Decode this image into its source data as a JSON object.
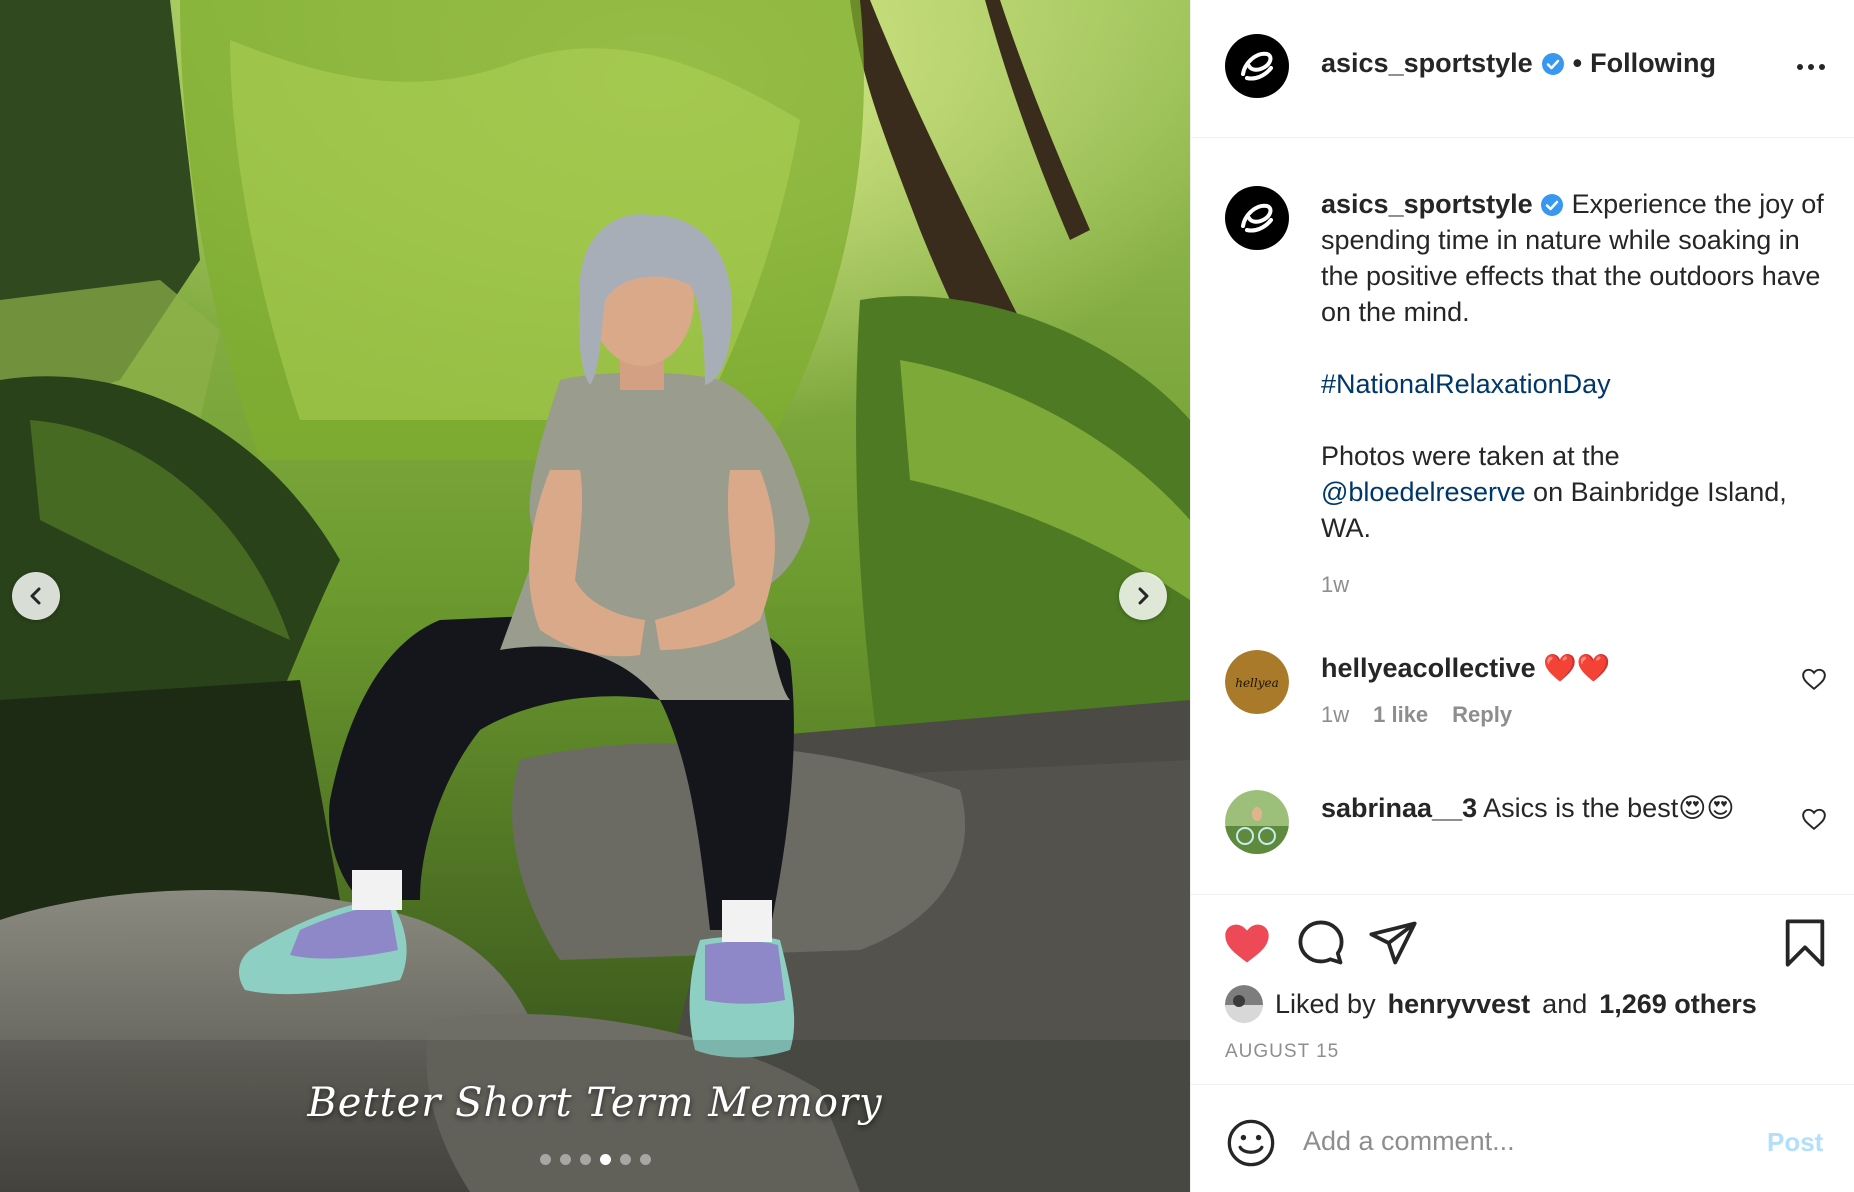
{
  "photo": {
    "overlay_text": "Better Short Term Memory",
    "slide_count": 6,
    "active_slide": 4
  },
  "header": {
    "username": "asics_sportstyle",
    "separator": "•",
    "follow_status": "Following"
  },
  "caption": {
    "username": "asics_sportstyle",
    "text_1": "Experience the joy of spending time in nature while soaking in the positive effects that the outdoors have on the mind.",
    "hashtag": "#NationalRelaxationDay",
    "text_2": "Photos were taken at the",
    "mention": "@bloedelreserve",
    "text_3": "on Bainbridge Island, WA.",
    "time": "1w"
  },
  "comments": [
    {
      "username": "hellyeacollective",
      "avatar_text": "hellyea",
      "text": "❤️❤️",
      "time": "1w",
      "likes": "1 like",
      "reply": "Reply"
    },
    {
      "username": "sabrinaa__3",
      "text": "Asics is the best😍😍"
    }
  ],
  "likes": {
    "prefix": "Liked by",
    "liker": "henryvvest",
    "conjunction": "and",
    "others": "1,269 others"
  },
  "date": "AUGUST 15",
  "add_comment": {
    "placeholder": "Add a comment...",
    "post_label": "Post"
  },
  "colors": {
    "like_red": "#ed4956",
    "link_blue": "#00376b",
    "verified_blue": "#3897f0",
    "post_disabled": "#b2dffc"
  },
  "icons": [
    "chevron-left-icon",
    "chevron-right-icon",
    "verified-badge-icon",
    "more-options-icon",
    "heart-icon",
    "comment-icon",
    "share-icon",
    "bookmark-icon",
    "emoji-icon"
  ]
}
